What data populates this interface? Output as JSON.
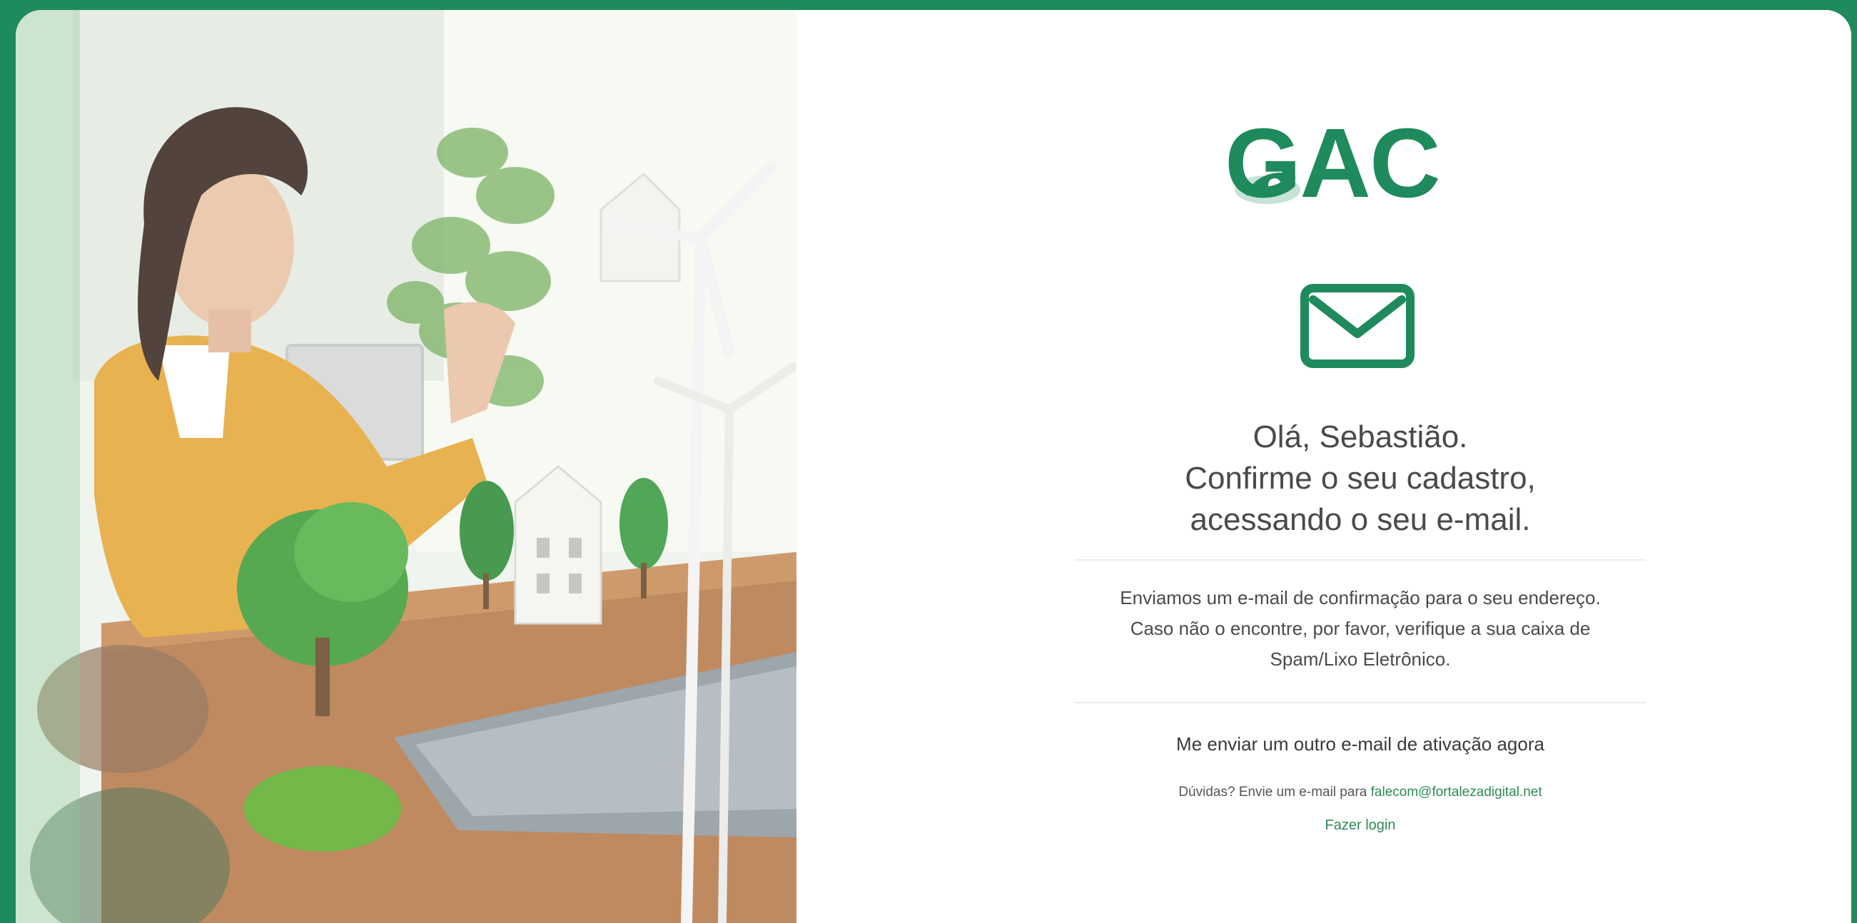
{
  "brand": {
    "logo_text": "GAC",
    "accent_color": "#1f8a5b",
    "link_color": "#2e8b57"
  },
  "icons": {
    "mail": "envelope-icon"
  },
  "greeting": {
    "line1": "Olá, Sebastião.",
    "line2": "Confirme o seu cadastro,",
    "line3": "acessando o seu e-mail."
  },
  "info": {
    "line1": "Enviamos um e-mail de confirmação para o seu endereço.",
    "line2": "Caso não o encontre, por favor, verifique a sua caixa de",
    "line3": "Spam/Lixo Eletrônico."
  },
  "actions": {
    "resend_label": "Me enviar um outro e-mail de ativação agora",
    "doubts_prefix": "Dúvidas? Envie um e-mail para",
    "support_email": "falecom@fortalezadigital.net",
    "login_label": "Fazer login"
  }
}
